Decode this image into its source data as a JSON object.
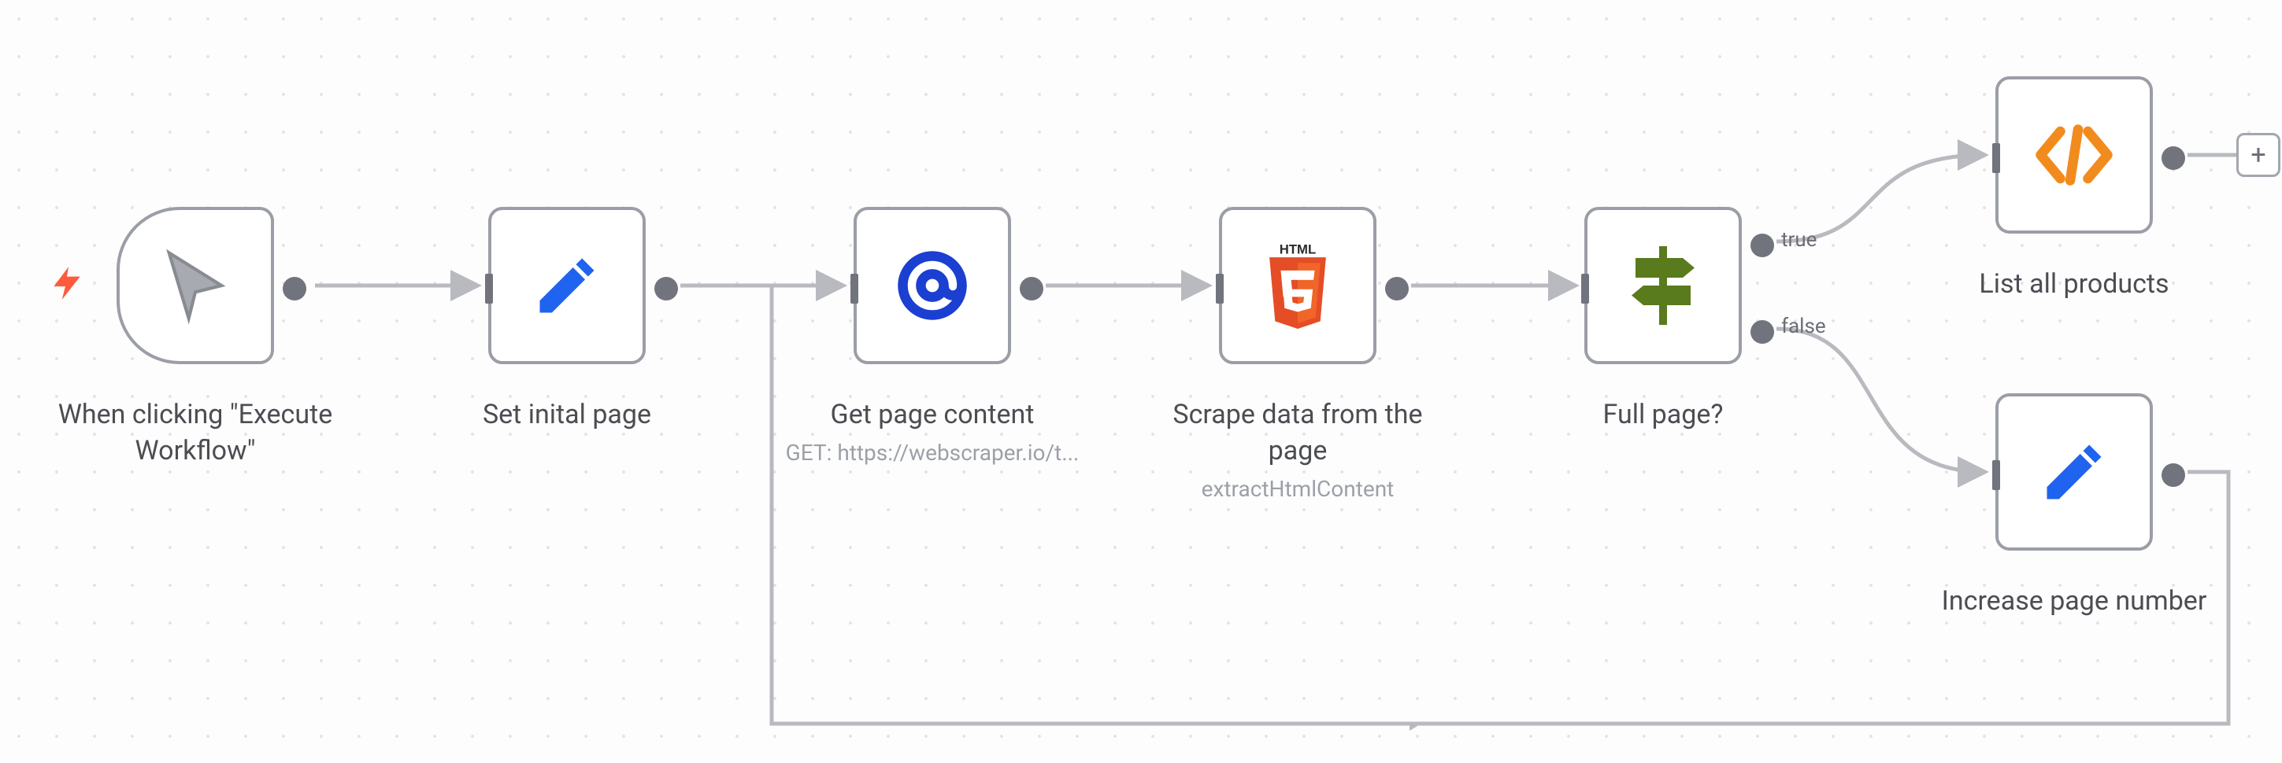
{
  "workflow": {
    "nodes": {
      "trigger": {
        "label": "When clicking \"Execute Workflow\""
      },
      "setInitial": {
        "label": "Set inital page"
      },
      "getPage": {
        "label": "Get page content",
        "sub": "GET: https://webscraper.io/t..."
      },
      "scrape": {
        "label": "Scrape data from the page",
        "sub": "extractHtmlContent"
      },
      "fullPage": {
        "label": "Full page?",
        "trueLabel": "true",
        "falseLabel": "false"
      },
      "listAll": {
        "label": "List all products"
      },
      "increase": {
        "label": "Increase page number"
      }
    },
    "addButton": "+"
  }
}
